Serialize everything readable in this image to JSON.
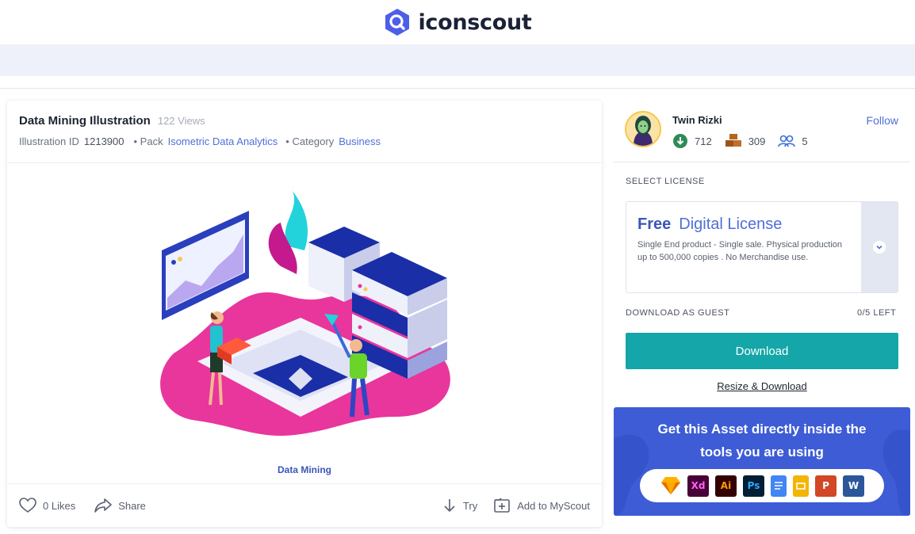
{
  "header": {
    "brand": "iconscout",
    "logo_icon": "magnifier-hexagon-icon",
    "brand_color": "#4d5ee8"
  },
  "asset": {
    "title": "Data Mining Illustration",
    "views": "122 Views",
    "id_label": "Illustration ID",
    "id_value": "1213900",
    "pack_label": "• Pack",
    "pack_value": "Isometric Data Analytics",
    "category_label": "• Category",
    "category_value": "Business",
    "caption": "Data Mining"
  },
  "actions": {
    "likes": "0 Likes",
    "share": "Share",
    "try": "Try",
    "add_to_myscout": "Add to MyScout"
  },
  "author": {
    "name": "Twin Rizki",
    "follow": "Follow",
    "stats": [
      {
        "icon": "download-circle-icon",
        "value": "712"
      },
      {
        "icon": "stack-boxes-icon",
        "value": "309"
      },
      {
        "icon": "users-icon",
        "value": "5"
      }
    ]
  },
  "license": {
    "section_label": "SELECT LICENSE",
    "tier": "Free",
    "name": "Digital License",
    "description": "Single End product - Single sale. Physical production up to 500,000 copies . No Merchandise use."
  },
  "download": {
    "guest_label": "DOWNLOAD AS GUEST",
    "remaining": "0/5 LEFT",
    "button": "Download",
    "resize_link": "Resize & Download"
  },
  "promo": {
    "line1": "Get this Asset directly inside the",
    "line2": "tools you are using",
    "tools": [
      {
        "name": "sketch-icon",
        "label": "",
        "bg": "#fdb300",
        "fg": "#ffffff"
      },
      {
        "name": "xd-icon",
        "label": "Xd",
        "bg": "#470137",
        "fg": "#ff61f6"
      },
      {
        "name": "illustrator-icon",
        "label": "Ai",
        "bg": "#330000",
        "fg": "#ff9a00"
      },
      {
        "name": "photoshop-icon",
        "label": "Ps",
        "bg": "#001e36",
        "fg": "#31a8ff"
      },
      {
        "name": "google-docs-icon",
        "label": "",
        "bg": "#4285f4",
        "fg": "#ffffff"
      },
      {
        "name": "google-slides-icon",
        "label": "",
        "bg": "#f4b400",
        "fg": "#ffffff"
      },
      {
        "name": "powerpoint-icon",
        "label": "P",
        "bg": "#d24726",
        "fg": "#ffffff"
      },
      {
        "name": "word-icon",
        "label": "W",
        "bg": "#2b579a",
        "fg": "#ffffff"
      }
    ]
  }
}
